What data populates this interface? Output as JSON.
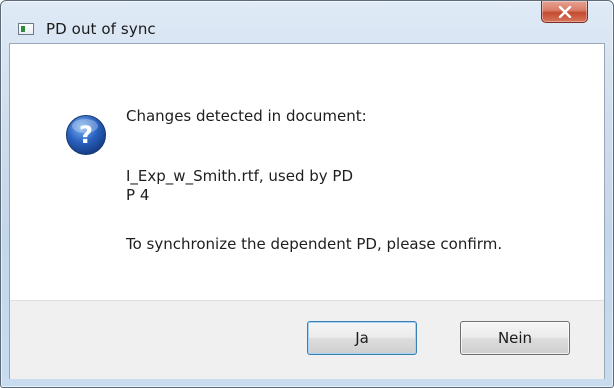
{
  "window": {
    "title": "PD out of sync",
    "app_icon": "window-app-icon",
    "close_icon": "close-icon"
  },
  "dialog": {
    "icon": "question-icon",
    "line1": "Changes detected in document:",
    "line2": "I_Exp_w_Smith.rtf, used by PD",
    "line3": "P 4",
    "line4": "To synchronize the dependent PD, please confirm."
  },
  "buttons": {
    "yes_label": "Ja",
    "no_label": "Nein"
  },
  "colors": {
    "title_bar": "#cfdeee",
    "close_button": "#c44a30",
    "question_icon": "#1e4fa3",
    "footer": "#f0f0f0"
  }
}
